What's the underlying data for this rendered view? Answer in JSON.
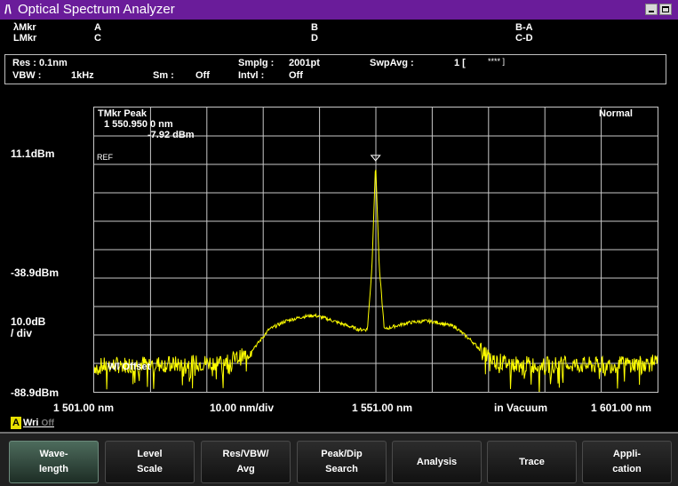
{
  "window": {
    "logo": "/\\",
    "title": "Optical Spectrum Analyzer"
  },
  "markers": {
    "row1": [
      "λMkr",
      "A",
      "B",
      "B-A"
    ],
    "row2": [
      "LMkr",
      "C",
      "D",
      "C-D"
    ]
  },
  "info": {
    "res": "Res : 0.1nm",
    "vbw": "VBW :",
    "vbw_val": "1kHz",
    "sm": "Sm :",
    "sm_val": "Off",
    "smplg": "Smplg :",
    "smplg_val": "2001pt",
    "intvl": "Intvl :",
    "intvl_val": "Off",
    "swpavg": "SwpAvg :",
    "swpavg_val": "1 [",
    "swpavg_stars": "**** ]"
  },
  "y_labels": {
    "top": "11.1dBm",
    "mid": "-38.9dBm",
    "scale": "10.0dB",
    "scale2": "/ div",
    "bottom": "-88.9dBm"
  },
  "x_labels": {
    "start": "1 501.00 nm",
    "div": "10.00 nm/div",
    "center": "1 551.00 nm",
    "medium": "in Vacuum",
    "stop": "1 601.00 nm"
  },
  "plot": {
    "tmkr": "TMkr   Peak",
    "tmkr_wl": "1 550.950 0   nm",
    "tmkr_lvl": "-7.92   dBm",
    "normal": "Normal",
    "ref": "REF",
    "wl_offset": "Wl Offset"
  },
  "mode": {
    "a": "A",
    "wri": "Wri",
    "off": "Off"
  },
  "softkeys": [
    {
      "label": "Wave-\nlength"
    },
    {
      "label": "Level\nScale"
    },
    {
      "label": "Res/VBW/\nAvg"
    },
    {
      "label": "Peak/Dip\nSearch"
    },
    {
      "label": "Analysis"
    },
    {
      "label": "Trace"
    },
    {
      "label": "Appli-\ncation"
    }
  ],
  "chart_data": {
    "type": "line",
    "xlabel": "",
    "ylabel": "",
    "xlim": [
      1501.0,
      1601.0
    ],
    "ylim": [
      -88.9,
      11.1
    ],
    "grid": true,
    "series": [
      {
        "color": "#ffff00",
        "x": [
          1501,
          1505,
          1510,
          1515,
          1520,
          1525,
          1528,
          1530,
          1532,
          1535,
          1538,
          1540,
          1542,
          1545,
          1548,
          1549.5,
          1550.3,
          1550.95,
          1551.6,
          1552.5,
          1554,
          1557,
          1560,
          1562,
          1565,
          1568,
          1570,
          1572,
          1575,
          1580,
          1585,
          1590,
          1595,
          1601
        ],
        "y": [
          -80,
          -79.5,
          -79,
          -79.3,
          -78.8,
          -78,
          -76,
          -72,
          -67,
          -64,
          -62.5,
          -62,
          -63,
          -65,
          -67,
          -67,
          -45,
          -7.92,
          -45,
          -67,
          -66,
          -64.5,
          -64,
          -64.5,
          -66,
          -71,
          -75,
          -78,
          -79,
          -79.5,
          -79.3,
          -79.6,
          -79.2,
          -78.8
        ]
      }
    ]
  },
  "colors": {
    "titlebar": "#6a1c9a",
    "trace": "#ffff00",
    "grid": "#c8c8c8"
  }
}
